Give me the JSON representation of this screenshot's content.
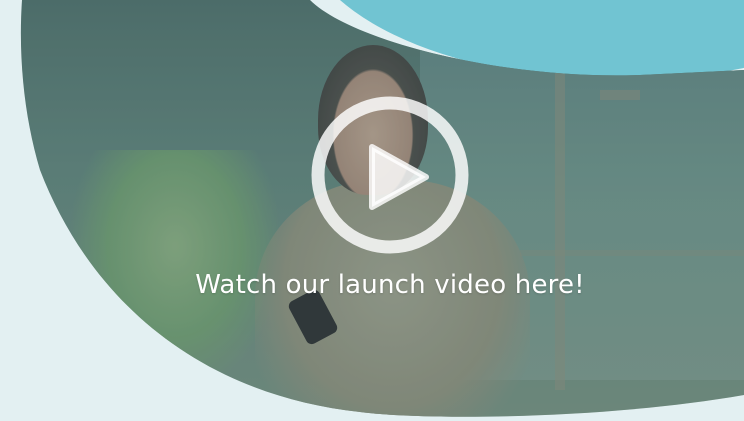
{
  "video": {
    "caption": "Watch our launch video here!",
    "play_icon": "play-icon"
  },
  "colors": {
    "purple_blob": "#a996d6",
    "teal_blob": "#71c4d2",
    "background": "#e3f0f2",
    "caption_text": "#ffffff"
  }
}
